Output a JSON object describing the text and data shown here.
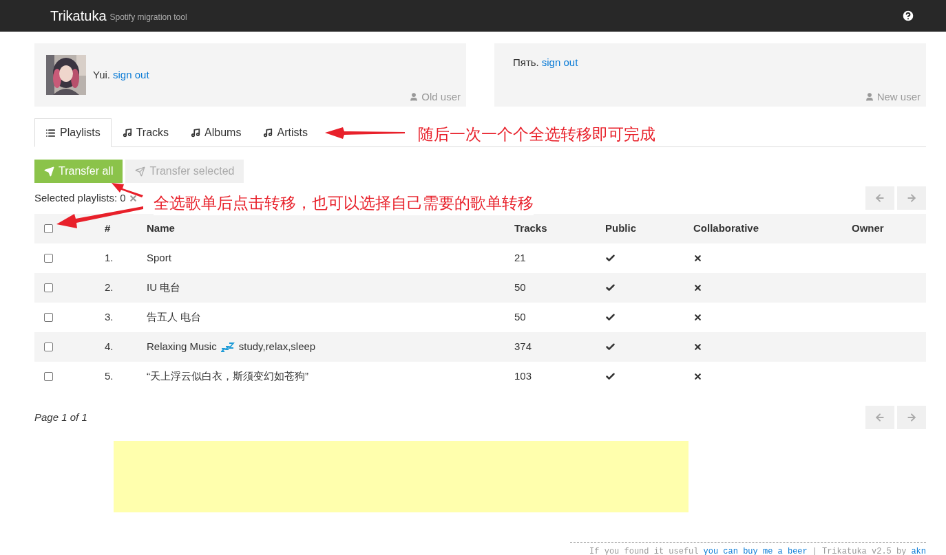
{
  "navbar": {
    "brand": "Trikatuka",
    "tagline": "Spotify migration tool"
  },
  "users": [
    {
      "name": "Yui.",
      "link": "sign out",
      "role": "Old user"
    },
    {
      "name": "Пять.",
      "link": "sign out",
      "role": "New user"
    }
  ],
  "tabs": [
    {
      "label": "Playlists",
      "kind": "list",
      "selected": true
    },
    {
      "label": "Tracks",
      "kind": "music",
      "selected": false
    },
    {
      "label": "Albums",
      "kind": "music",
      "selected": false
    },
    {
      "label": "Artists",
      "kind": "music",
      "selected": false
    }
  ],
  "actions": [
    {
      "label": "Transfer all",
      "disabled": false
    },
    {
      "label": "Transfer selected",
      "disabled": true
    }
  ],
  "selection": {
    "label": "Selected playlists: 0"
  },
  "table": {
    "columns": [
      "#",
      "Name",
      "Tracks",
      "Public",
      "Collaborative",
      "Owner"
    ],
    "all_checked": false,
    "rows": [
      {
        "checked": false,
        "index": "1.",
        "name": [
          "Sport"
        ],
        "tracks": "21",
        "public": true,
        "collaborative": false
      },
      {
        "checked": false,
        "index": "2.",
        "name": [
          "IU 电台"
        ],
        "tracks": "50",
        "public": true,
        "collaborative": false
      },
      {
        "checked": false,
        "index": "3.",
        "name": [
          "告五人 电台"
        ],
        "tracks": "50",
        "public": true,
        "collaborative": false
      },
      {
        "checked": false,
        "index": "4.",
        "name": [
          "Relaxing Music",
          "study,relax,sleep"
        ],
        "tracks": "374",
        "public": true,
        "collaborative": false
      },
      {
        "checked": false,
        "index": "5.",
        "name": [
          "“天上浮云似白衣，斯须变幻如苍狗”"
        ],
        "tracks": "103",
        "public": true,
        "collaborative": false
      }
    ]
  },
  "pagination": {
    "label": "Page 1 of 1"
  },
  "footer": {
    "text": "If you found it useful",
    "link": "you can buy me a beer",
    "separator": "|",
    "version": "Trikatuka v2.5 by",
    "author": "akn"
  },
  "annotations": [
    {
      "text": "随后一次一个个全选转移即可完成"
    },
    {
      "text": "全选歌单后点击转移，也可以选择自己需要的歌单转移"
    }
  ]
}
